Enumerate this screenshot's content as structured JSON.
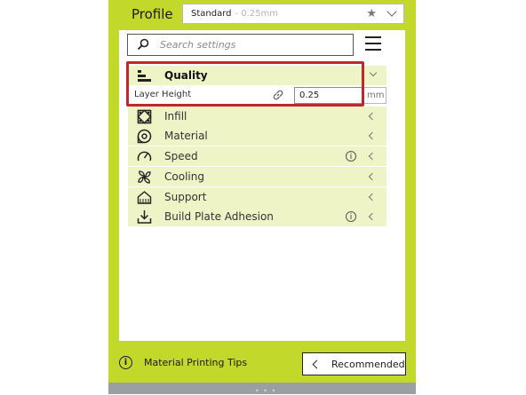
{
  "header": {
    "profile_label": "Profile",
    "profile_name": "Standard",
    "profile_layer": "- 0.25mm",
    "favorite_icon": "star-icon",
    "dropdown_icon": "chevron-down-icon"
  },
  "search": {
    "placeholder": "Search settings",
    "icon": "search-icon",
    "menu_icon": "hamburger-menu-icon"
  },
  "categories": [
    {
      "label": "Quality",
      "icon": "quality-icon",
      "expanded": true
    },
    {
      "label": "Infill",
      "icon": "infill-icon"
    },
    {
      "label": "Material",
      "icon": "material-icon"
    },
    {
      "label": "Speed",
      "icon": "speed-icon",
      "info": true
    },
    {
      "label": "Cooling",
      "icon": "cooling-fan-icon"
    },
    {
      "label": "Support",
      "icon": "support-icon"
    },
    {
      "label": "Build Plate Adhesion",
      "icon": "build-plate-icon",
      "info": true
    }
  ],
  "setting": {
    "label": "Layer Height",
    "value": "0.25",
    "unit": "mm",
    "link_icon": "link-icon"
  },
  "footer": {
    "tips_label": "Material Printing Tips",
    "tips_icon": "info-icon",
    "recommended_label": "Recommended",
    "recommended_icon": "chevron-left-icon"
  },
  "colors": {
    "panel": "#c2d82a",
    "row_background": "#eef4c6",
    "highlight": "#c0272d"
  }
}
